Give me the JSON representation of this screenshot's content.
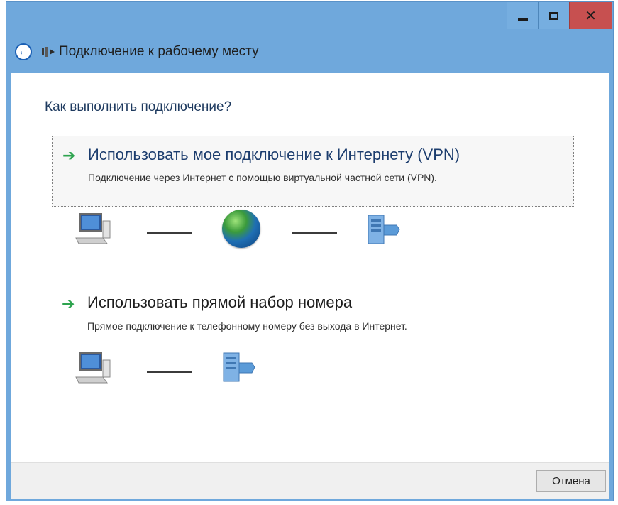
{
  "window": {
    "title": "Подключение к рабочему месту",
    "controls": {
      "minimize": "minimize",
      "maximize": "maximize",
      "close": "close"
    }
  },
  "question": "Как выполнить подключение?",
  "options": [
    {
      "title": "Использовать мое подключение к Интернету (VPN)",
      "description": "Подключение через Интернет с помощью виртуальной частной сети (VPN)."
    },
    {
      "title": "Использовать прямой набор номера",
      "description": "Прямое подключение к телефонному номеру без выхода в Интернет."
    }
  ],
  "footer": {
    "cancel_label": "Отмена"
  },
  "icons": {
    "back": "back-arrow-icon",
    "wizard": "network-wizard-icon",
    "option_arrow": "green-arrow-icon",
    "computer": "computer-icon",
    "globe": "globe-icon",
    "server": "server-icon"
  },
  "colors": {
    "frame": "#6fa8dc",
    "close_button": "#c75050",
    "arrow_green": "#2ea44f",
    "link_blue": "#1c3d6e"
  }
}
